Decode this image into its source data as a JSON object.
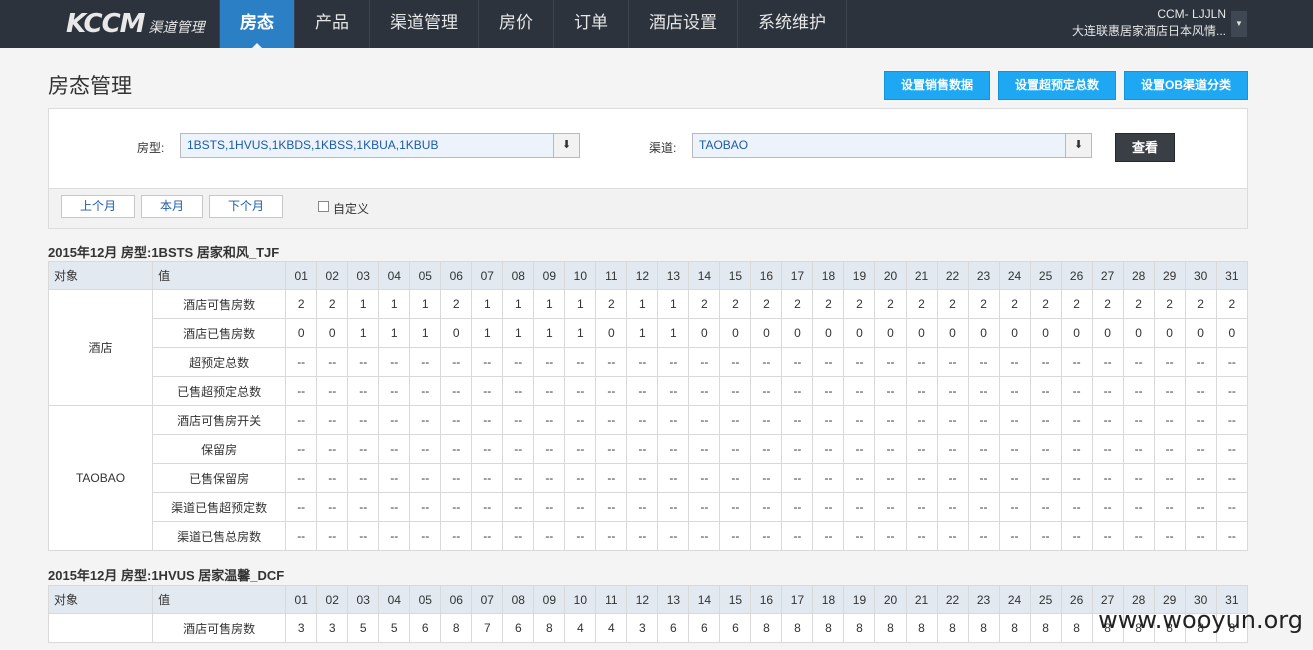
{
  "brand": {
    "mark": "KCCM",
    "sub": "渠道管理"
  },
  "nav": [
    {
      "label": "房态",
      "active": true
    },
    {
      "label": "产品"
    },
    {
      "label": "渠道管理"
    },
    {
      "label": "房价"
    },
    {
      "label": "订单"
    },
    {
      "label": "酒店设置"
    },
    {
      "label": "系统维护"
    }
  ],
  "user": {
    "id": "CCM- LJJLN",
    "hotel": "大连联惠居家酒店日本风情..."
  },
  "page": {
    "title": "房态管理"
  },
  "actions": [
    "设置销售数据",
    "设置超预定总数",
    "设置OB渠道分类"
  ],
  "filter": {
    "room_label": "房型:",
    "room_value": "1BSTS,1HVUS,1KBDS,1KBSS,1KBUA,1KBUB",
    "channel_label": "渠道:",
    "channel_value": "TAOBAO",
    "query_label": "查看",
    "months": [
      "上个月",
      "本月",
      "下个月"
    ],
    "custom_label": "自定义"
  },
  "table_headers": {
    "obj": "对象",
    "val": "值"
  },
  "days": [
    "01",
    "02",
    "03",
    "04",
    "05",
    "06",
    "07",
    "08",
    "09",
    "10",
    "11",
    "12",
    "13",
    "14",
    "15",
    "16",
    "17",
    "18",
    "19",
    "20",
    "21",
    "22",
    "23",
    "24",
    "25",
    "26",
    "27",
    "28",
    "29",
    "30",
    "31"
  ],
  "sections": [
    {
      "title": "2015年12月 房型:1BSTS 居家和风_TJF",
      "groups": [
        {
          "object": "酒店",
          "rows": [
            {
              "label": "酒店可售房数",
              "values": [
                "2",
                "2",
                "1",
                "1",
                "1",
                "2",
                "1",
                "1",
                "1",
                "1",
                "2",
                "1",
                "1",
                "2",
                "2",
                "2",
                "2",
                "2",
                "2",
                "2",
                "2",
                "2",
                "2",
                "2",
                "2",
                "2",
                "2",
                "2",
                "2",
                "2",
                "2"
              ]
            },
            {
              "label": "酒店已售房数",
              "values": [
                "0",
                "0",
                "1",
                "1",
                "1",
                "0",
                "1",
                "1",
                "1",
                "1",
                "0",
                "1",
                "1",
                "0",
                "0",
                "0",
                "0",
                "0",
                "0",
                "0",
                "0",
                "0",
                "0",
                "0",
                "0",
                "0",
                "0",
                "0",
                "0",
                "0",
                "0"
              ]
            },
            {
              "label": "超预定总数",
              "values": [
                "--",
                "--",
                "--",
                "--",
                "--",
                "--",
                "--",
                "--",
                "--",
                "--",
                "--",
                "--",
                "--",
                "--",
                "--",
                "--",
                "--",
                "--",
                "--",
                "--",
                "--",
                "--",
                "--",
                "--",
                "--",
                "--",
                "--",
                "--",
                "--",
                "--",
                "--"
              ]
            },
            {
              "label": "已售超预定总数",
              "values": [
                "--",
                "--",
                "--",
                "--",
                "--",
                "--",
                "--",
                "--",
                "--",
                "--",
                "--",
                "--",
                "--",
                "--",
                "--",
                "--",
                "--",
                "--",
                "--",
                "--",
                "--",
                "--",
                "--",
                "--",
                "--",
                "--",
                "--",
                "--",
                "--",
                "--",
                "--"
              ]
            }
          ]
        },
        {
          "object": "TAOBAO",
          "rows": [
            {
              "label": "酒店可售房开关",
              "values": [
                "--",
                "--",
                "--",
                "--",
                "--",
                "--",
                "--",
                "--",
                "--",
                "--",
                "--",
                "--",
                "--",
                "--",
                "--",
                "--",
                "--",
                "--",
                "--",
                "--",
                "--",
                "--",
                "--",
                "--",
                "--",
                "--",
                "--",
                "--",
                "--",
                "--",
                "--"
              ]
            },
            {
              "label": "保留房",
              "values": [
                "--",
                "--",
                "--",
                "--",
                "--",
                "--",
                "--",
                "--",
                "--",
                "--",
                "--",
                "--",
                "--",
                "--",
                "--",
                "--",
                "--",
                "--",
                "--",
                "--",
                "--",
                "--",
                "--",
                "--",
                "--",
                "--",
                "--",
                "--",
                "--",
                "--",
                "--"
              ]
            },
            {
              "label": "已售保留房",
              "values": [
                "--",
                "--",
                "--",
                "--",
                "--",
                "--",
                "--",
                "--",
                "--",
                "--",
                "--",
                "--",
                "--",
                "--",
                "--",
                "--",
                "--",
                "--",
                "--",
                "--",
                "--",
                "--",
                "--",
                "--",
                "--",
                "--",
                "--",
                "--",
                "--",
                "--",
                "--"
              ]
            },
            {
              "label": "渠道已售超预定数",
              "values": [
                "--",
                "--",
                "--",
                "--",
                "--",
                "--",
                "--",
                "--",
                "--",
                "--",
                "--",
                "--",
                "--",
                "--",
                "--",
                "--",
                "--",
                "--",
                "--",
                "--",
                "--",
                "--",
                "--",
                "--",
                "--",
                "--",
                "--",
                "--",
                "--",
                "--",
                "--"
              ]
            },
            {
              "label": "渠道已售总房数",
              "values": [
                "--",
                "--",
                "--",
                "--",
                "--",
                "--",
                "--",
                "--",
                "--",
                "--",
                "--",
                "--",
                "--",
                "--",
                "--",
                "--",
                "--",
                "--",
                "--",
                "--",
                "--",
                "--",
                "--",
                "--",
                "--",
                "--",
                "--",
                "--",
                "--",
                "--",
                "--"
              ]
            }
          ]
        }
      ]
    },
    {
      "title": "2015年12月 房型:1HVUS 居家温馨_DCF",
      "groups": [
        {
          "object": "",
          "rows": [
            {
              "label": "酒店可售房数",
              "values": [
                "3",
                "3",
                "5",
                "5",
                "6",
                "8",
                "7",
                "6",
                "8",
                "4",
                "4",
                "3",
                "6",
                "6",
                "6",
                "8",
                "8",
                "8",
                "8",
                "8",
                "8",
                "8",
                "8",
                "8",
                "8",
                "8",
                "8",
                "8",
                "8",
                "8",
                "8"
              ]
            }
          ]
        }
      ]
    }
  ],
  "watermark": "www.wooyun.org"
}
